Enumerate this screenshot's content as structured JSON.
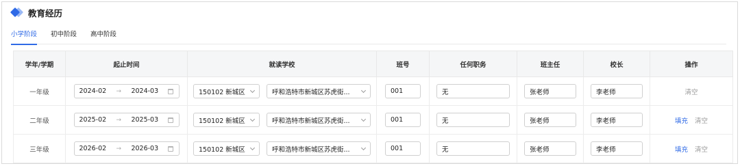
{
  "section_title": "教育经历",
  "tabs": [
    {
      "label": "小学阶段",
      "active": true
    },
    {
      "label": "初中阶段",
      "active": false
    },
    {
      "label": "高中阶段",
      "active": false
    }
  ],
  "columns": [
    "学年/学期",
    "起止时间",
    "就读学校",
    "班号",
    "任何职务",
    "班主任",
    "校长",
    "操作"
  ],
  "rows": [
    {
      "grade": "一年级",
      "start": "2024-02",
      "end": "2024-03",
      "district": "150102 新城区",
      "school": "呼和浩特市新城区苏虎街...",
      "class_no": "001",
      "duty": "无",
      "head_teacher": "张老师",
      "principal": "李老师",
      "actions": [
        "清空"
      ]
    },
    {
      "grade": "二年级",
      "start": "2025-02",
      "end": "2025-03",
      "district": "150102 新城区",
      "school": "呼和浩特市新城区苏虎街...",
      "class_no": "001",
      "duty": "无",
      "head_teacher": "张老师",
      "principal": "李老师",
      "actions": [
        "填充",
        "清空"
      ]
    },
    {
      "grade": "三年级",
      "start": "2026-02",
      "end": "2026-03",
      "district": "150102 新城区",
      "school": "呼和浩特市新城区苏虎街...",
      "class_no": "001",
      "duty": "无",
      "head_teacher": "张老师",
      "principal": "李老师",
      "actions": [
        "填充",
        "清空"
      ]
    }
  ],
  "range_separator": "→",
  "colors": {
    "accent": "#2f6ae6",
    "header_bg": "#f5f6f7",
    "muted": "#999999"
  }
}
